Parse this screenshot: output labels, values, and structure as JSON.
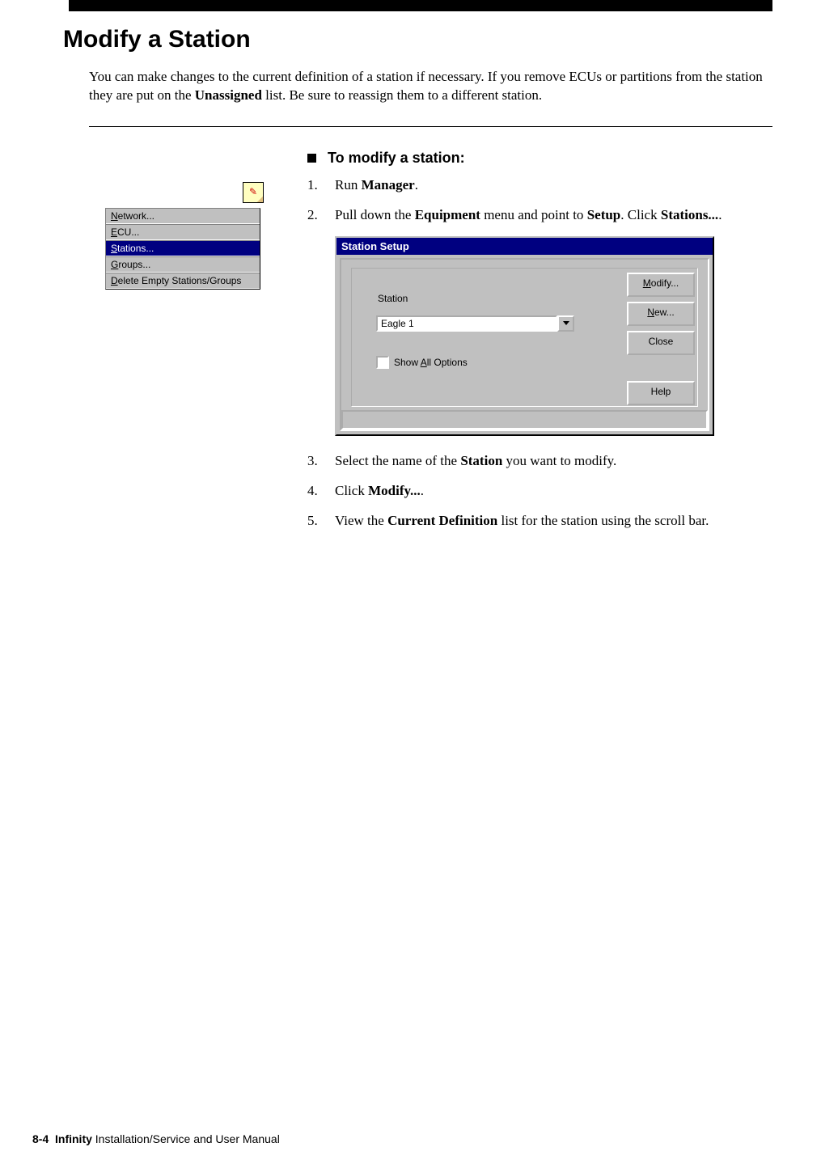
{
  "header": {
    "page_title": "Modify a Station"
  },
  "intro": {
    "pre": "You can make changes to the current definition of a station if necessary. If you remove ECUs or partitions from the station they are put on the ",
    "bold": "Unassigned",
    "post": " list. Be sure to reassign them to a different station."
  },
  "menu": {
    "items": [
      {
        "pre": "",
        "u": "N",
        "post": "etwork..."
      },
      {
        "pre": "",
        "u": "E",
        "post": "CU..."
      },
      {
        "pre": "",
        "u": "S",
        "post": "tations..."
      },
      {
        "pre": "",
        "u": "G",
        "post": "roups..."
      },
      {
        "pre": "",
        "u": "D",
        "post": "elete Empty Stations/Groups"
      }
    ],
    "selected_index": 2
  },
  "procedure": {
    "title": "To modify a station:",
    "steps": [
      {
        "num": "1.",
        "parts": [
          "Run ",
          {
            "b": "Manager"
          },
          "."
        ]
      },
      {
        "num": "2.",
        "parts": [
          "Pull down the ",
          {
            "b": "Equipment"
          },
          " menu and point to ",
          {
            "b": "Setup"
          },
          ". Click ",
          {
            "b": "Stations..."
          },
          "."
        ]
      },
      {
        "num": "3.",
        "parts": [
          "Select the name of the ",
          {
            "b": "Station"
          },
          " you want to modify."
        ]
      },
      {
        "num": "4.",
        "parts": [
          "Click ",
          {
            "b": "Modify..."
          },
          "."
        ]
      },
      {
        "num": "5.",
        "parts": [
          "View the ",
          {
            "b": "Current Definition"
          },
          " list for the station using the scroll bar."
        ]
      }
    ]
  },
  "dialog": {
    "title": "Station Setup",
    "station_label": "Station",
    "station_value": "Eagle 1",
    "show_all": {
      "pre": "Show ",
      "u": "A",
      "post": "ll Options"
    },
    "buttons": {
      "modify": {
        "pre": "",
        "u": "M",
        "post": "odify..."
      },
      "new": {
        "pre": "",
        "u": "N",
        "post": "ew..."
      },
      "close": "Close",
      "help": "Help"
    }
  },
  "footer": {
    "page_num": "8-4",
    "product": "Infinity",
    "rest": " Installation/Service and User Manual"
  }
}
